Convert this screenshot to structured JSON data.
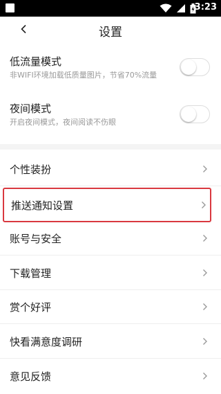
{
  "status_bar": {
    "time": "3:23",
    "icons": [
      "square-icon",
      "wifi-icon",
      "signal-icon",
      "battery-icon"
    ]
  },
  "header": {
    "title": "设置",
    "back_icon": "chevron-left-icon"
  },
  "toggles": [
    {
      "label": "低流量模式",
      "description": "非WIFI环境加载低质量图片，节省70%流量",
      "on": false
    },
    {
      "label": "夜间模式",
      "description": "开启夜间模式，夜间阅读不伤眼",
      "on": false
    }
  ],
  "menu_items": [
    {
      "label": "个性装扮"
    },
    {
      "label": "推送通知设置"
    },
    {
      "label": "账号与安全"
    },
    {
      "label": "下载管理"
    },
    {
      "label": "赏个好评"
    },
    {
      "label": "快看满意度调研"
    },
    {
      "label": "意见反馈"
    }
  ],
  "colors": {
    "highlight_border": "#d9383f",
    "separator": "#f4f4f4",
    "chevron": "#999999"
  }
}
